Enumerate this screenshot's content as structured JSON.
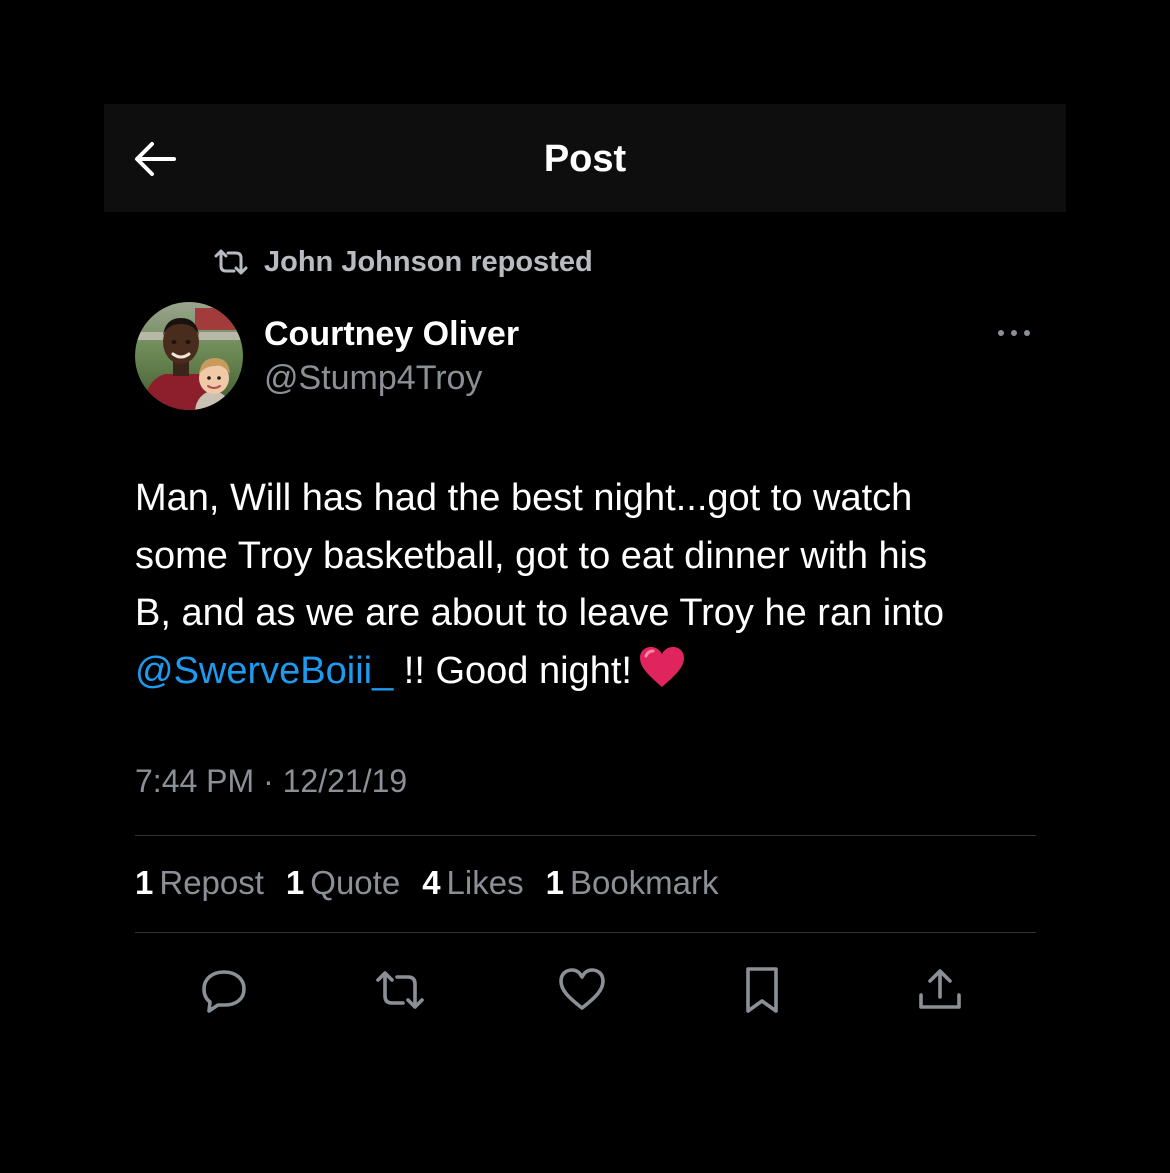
{
  "header": {
    "title": "Post",
    "back_icon": "arrow-left-icon"
  },
  "repost": {
    "icon": "repost-icon",
    "text": "John Johnson reposted"
  },
  "author": {
    "name": "Courtney Oliver",
    "handle": "@Stump4Troy",
    "more_icon": "more-options-icon"
  },
  "tweet": {
    "text_line1": "Man, Will has had the best night...got to watch",
    "text_line2": "some Troy basketball, got to eat dinner with his",
    "text_line3": "B, and as we are about to leave Troy he ran into",
    "mention": "@SwerveBoiii_",
    "text_after_mention": " !! Good night!",
    "emoji": "red-heart-emoji"
  },
  "timestamp": {
    "time": "7:44 PM",
    "separator": " · ",
    "date": "12/21/19"
  },
  "stats": [
    {
      "count": "1",
      "label": "Repost"
    },
    {
      "count": "1",
      "label": "Quote"
    },
    {
      "count": "4",
      "label": "Likes"
    },
    {
      "count": "1",
      "label": "Bookmark"
    }
  ],
  "actions": [
    {
      "name": "reply",
      "icon": "reply-icon"
    },
    {
      "name": "repost",
      "icon": "repost-icon"
    },
    {
      "name": "like",
      "icon": "heart-icon"
    },
    {
      "name": "bookmark",
      "icon": "bookmark-icon"
    },
    {
      "name": "share",
      "icon": "share-icon"
    }
  ],
  "colors": {
    "background": "#000000",
    "header_background": "#0e0e0e",
    "text_primary": "#ffffff",
    "text_secondary": "#8b9096",
    "link": "#1d9bf0",
    "divider": "#2f3336",
    "heart_emoji": "#e0245e"
  }
}
